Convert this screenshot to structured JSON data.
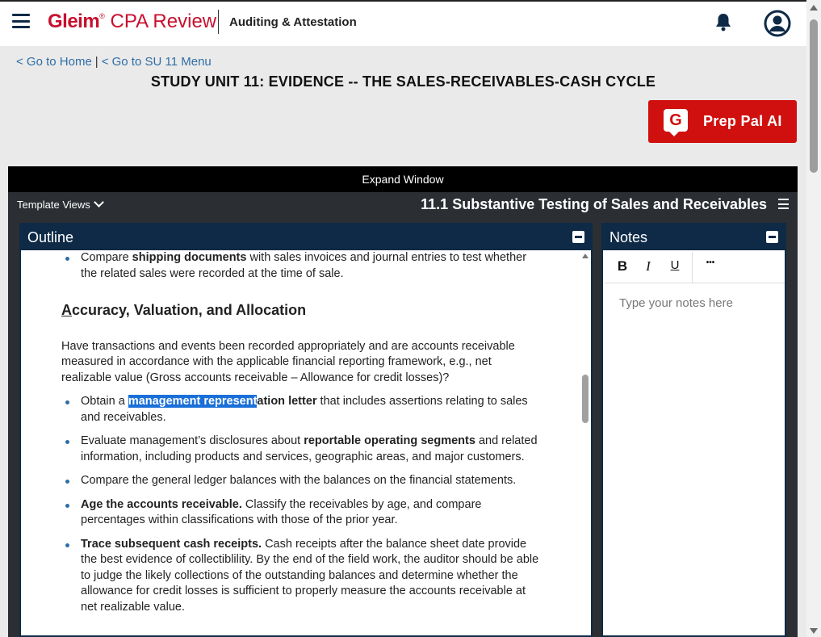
{
  "header": {
    "logo_brand": "Gleim",
    "logo_product": "CPA Review",
    "course": "Auditing & Attestation"
  },
  "breadcrumbs": {
    "home": "< Go to Home",
    "separator": "|",
    "menu": "< Go to SU 11 Menu"
  },
  "unit_title": "STUDY UNIT 11: EVIDENCE -- THE SALES-RECEIVABLES-CASH CYCLE",
  "prep_pal": {
    "icon_letter": "G",
    "label": "Prep Pal AI"
  },
  "frame": {
    "expand_label": "Expand Window",
    "template_views": "Template Views",
    "section_title": "11.1 Substantive Testing of Sales and Receivables"
  },
  "outline": {
    "title": "Outline",
    "b0_pre": "Compare ",
    "b0_bold": "shipping documents",
    "b0_post": " with sales invoices and journal entries to test whether the related sales were recorded at the time of sale.",
    "heading_first": "A",
    "heading_rest": "ccuracy, Valuation, and Allocation",
    "intro": "Have transactions and events been recorded appropriately and are accounts receivable measured in accordance with the applicable financial reporting framework, e.g., net realizable value (Gross accounts receivable – Allowance for credit losses)?",
    "b1_pre": "Obtain a ",
    "b1_hl": "management represent",
    "b1_bold": "ation letter",
    "b1_post": " that includes assertions relating to sales and receivables.",
    "b2_pre": "Evaluate management’s disclosures about ",
    "b2_bold": "reportable operating segments",
    "b2_post": " and related information, including products and services, geographic areas, and major customers.",
    "b3": "Compare the general ledger balances with the balances on the financial statements.",
    "b4_bold": "Age the accounts receivable.",
    "b4_post": " Classify the receivables by age, and compare percentages within classifications with those of the prior year.",
    "b5_bold": "Trace subsequent cash receipts.",
    "b5_post": " Cash receipts after the balance sheet date provide the best evidence of collectiblility. By the end of the field work, the auditor should be able to judge the likely collections of the outstanding balances and determine whether the allowance for credit losses is sufficient to properly measure the accounts receivable at net realizable value."
  },
  "notes": {
    "title": "Notes",
    "bold": "B",
    "italic": "I",
    "underline": "U",
    "more": "•••",
    "placeholder": "Type your notes here"
  }
}
